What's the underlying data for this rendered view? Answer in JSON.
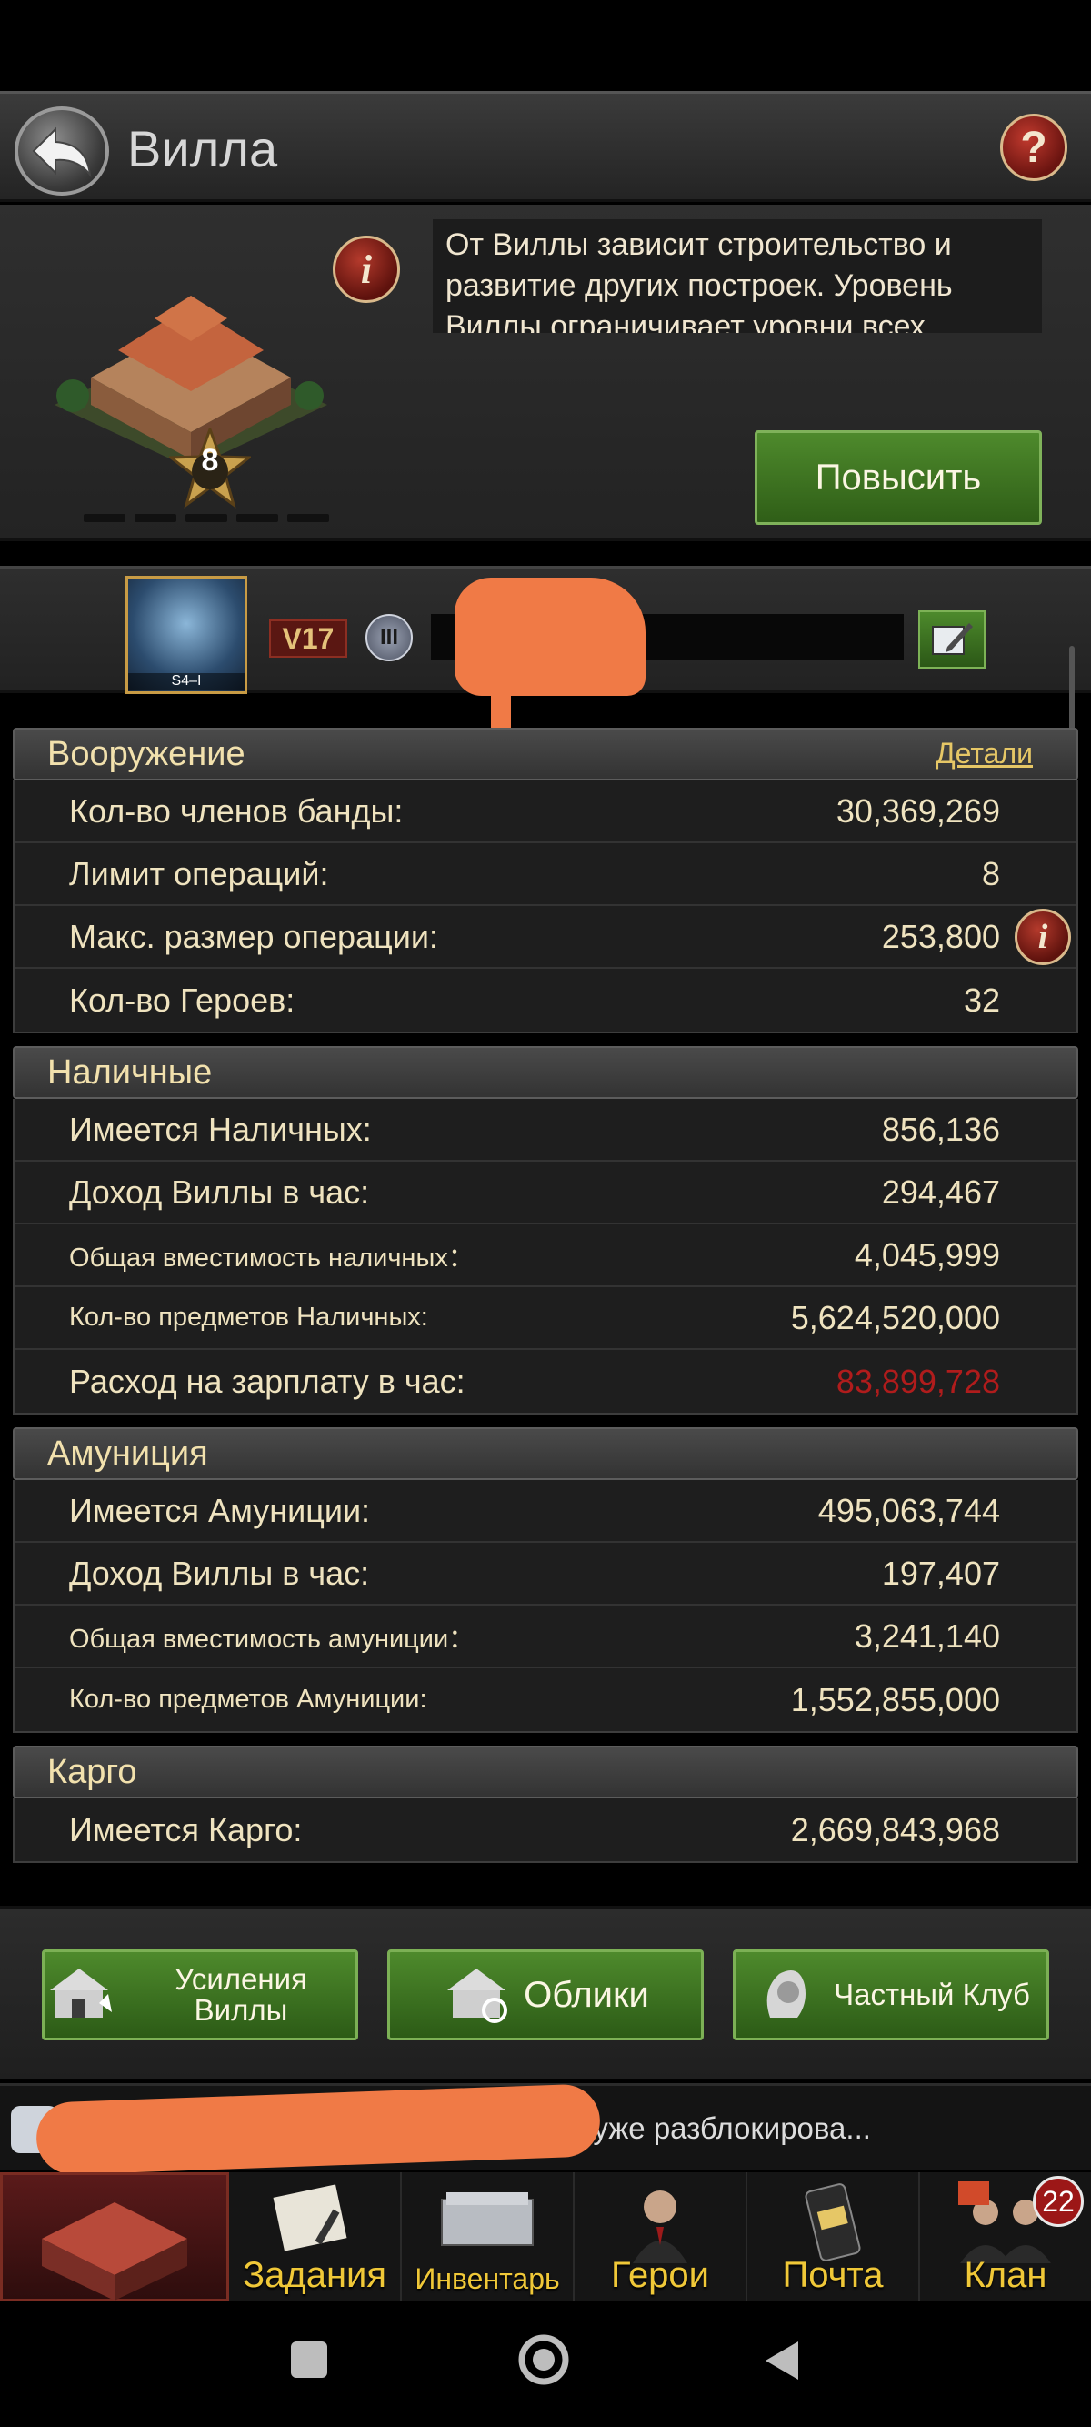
{
  "header": {
    "title": "Вилла"
  },
  "villa": {
    "level": "8",
    "description": "От Виллы зависит строительство и развитие других построек. Уровень Виллы ограничивает уровни всех",
    "upgrade_label": "Повысить"
  },
  "player": {
    "avatar_label": "S4–I",
    "vip": "V17",
    "rank": "III"
  },
  "sections": {
    "armament": {
      "title": "Вооружение",
      "details_label": "Детали",
      "rows": [
        {
          "label": "Кол-во членов банды:",
          "value": "30,369,269"
        },
        {
          "label": "Лимит операций:",
          "value": "8"
        },
        {
          "label": "Макс. размер операции:",
          "value": "253,800"
        },
        {
          "label": "Кол-во Героев:",
          "value": "32"
        }
      ]
    },
    "cash": {
      "title": "Наличные",
      "rows": [
        {
          "label": "Имеется Наличных:",
          "value": "856,136"
        },
        {
          "label": "Доход Виллы в час:",
          "value": "294,467"
        },
        {
          "label": "Общая вместимость наличных：",
          "value": "4,045,999"
        },
        {
          "label": "Кол-во предметов Наличных:",
          "value": "5,624,520,000"
        },
        {
          "label": "Расход на зарплату в час:",
          "value": "83,899,728"
        }
      ]
    },
    "ammo": {
      "title": "Амуниция",
      "rows": [
        {
          "label": "Имеется Амуниции:",
          "value": "495,063,744"
        },
        {
          "label": "Доход Виллы в час:",
          "value": "197,407"
        },
        {
          "label": "Общая вместимость амуниции：",
          "value": "3,241,140"
        },
        {
          "label": "Кол-во предметов Амуниции:",
          "value": "1,552,855,000"
        }
      ]
    },
    "cargo": {
      "title": "Карго",
      "rows": [
        {
          "label": "Имеется Карго:",
          "value": "2,669,843,968"
        }
      ]
    }
  },
  "actions": {
    "boosts": "Усиления Виллы",
    "skins": "Облики",
    "club": "Частный Клуб"
  },
  "chat": {
    "message": "[...] Kapsel ... вое оружие героя Тэнгу уже разблокирова..."
  },
  "nav": {
    "tasks": "Задания",
    "inventory": "Инвентарь",
    "heroes": "Герои",
    "mail": "Почта",
    "clan": "Клан",
    "clan_badge": "22"
  },
  "colors": {
    "accent_green": "#3e7322",
    "gold_text": "#f0c838",
    "negative": "#b01c1c"
  }
}
